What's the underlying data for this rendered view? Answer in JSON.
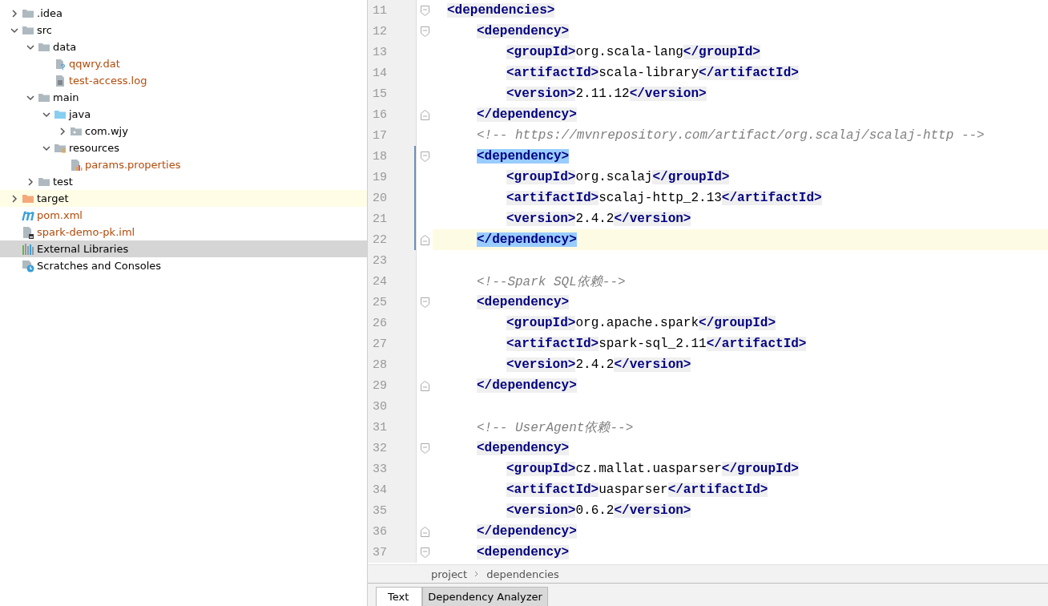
{
  "project_tree": [
    {
      "name": ".idea",
      "kind": "folder",
      "expanded": false,
      "untracked": false,
      "selected": false,
      "hovered": false
    },
    {
      "name": "src",
      "kind": "folder",
      "expanded": true,
      "untracked": false,
      "selected": false,
      "hovered": false,
      "children": [
        {
          "name": "data",
          "kind": "folder",
          "expanded": true,
          "untracked": false,
          "selected": false,
          "hovered": false,
          "children": [
            {
              "name": "qqwry.dat",
              "kind": "unknown-file",
              "untracked": true,
              "selected": false,
              "hovered": false
            },
            {
              "name": "test-access.log",
              "kind": "text-file",
              "untracked": true,
              "selected": false,
              "hovered": false
            }
          ]
        },
        {
          "name": "main",
          "kind": "folder",
          "expanded": true,
          "untracked": false,
          "selected": false,
          "hovered": false,
          "children": [
            {
              "name": "java",
              "kind": "source-folder",
              "expanded": true,
              "untracked": false,
              "selected": false,
              "hovered": false,
              "children": [
                {
                  "name": "com.wjy",
                  "kind": "package",
                  "expanded": false,
                  "untracked": false,
                  "selected": false,
                  "hovered": false
                }
              ]
            },
            {
              "name": "resources",
              "kind": "resource-folder",
              "expanded": true,
              "untracked": false,
              "selected": false,
              "hovered": false,
              "children": [
                {
                  "name": "params.properties",
                  "kind": "properties-file",
                  "untracked": true,
                  "selected": false,
                  "hovered": false
                }
              ]
            }
          ]
        },
        {
          "name": "test",
          "kind": "folder",
          "expanded": false,
          "untracked": false,
          "selected": false,
          "hovered": false
        }
      ]
    },
    {
      "name": "target",
      "kind": "excluded-folder",
      "expanded": false,
      "untracked": false,
      "selected": false,
      "hovered": true
    },
    {
      "name": "pom.xml",
      "kind": "maven-file",
      "untracked": true,
      "selected": false,
      "hovered": false
    },
    {
      "name": "spark-demo-pk.iml",
      "kind": "module-file",
      "untracked": true,
      "selected": false,
      "hovered": false
    }
  ],
  "tree_roots": [
    {
      "name": "External Libraries",
      "kind": "libraries",
      "selected": true
    },
    {
      "name": "Scratches and Consoles",
      "kind": "scratches",
      "selected": false
    }
  ],
  "editor": {
    "lines": [
      {
        "number": "11",
        "kind": "tag",
        "open": "<dependencies>",
        "fold_start": true,
        "changed": false,
        "current": false,
        "matched": false,
        "children": [
          {
            "number": "12",
            "kind": "tag",
            "open": "<dependency>",
            "fold_start": true,
            "changed": false,
            "current": false,
            "matched": false,
            "children": [
              {
                "number": "13",
                "kind": "element",
                "open": "<groupId>",
                "value": "org.scala-lang",
                "close": "</groupId>",
                "changed": false,
                "current": false,
                "matched": false
              },
              {
                "number": "14",
                "kind": "element",
                "open": "<artifactId>",
                "value": "scala-library",
                "close": "</artifactId>",
                "changed": false,
                "current": false,
                "matched": false
              },
              {
                "number": "15",
                "kind": "element",
                "open": "<version>",
                "value": "2.11.12",
                "close": "</version>",
                "changed": false,
                "current": false,
                "matched": false
              }
            ]
          },
          {
            "number": "16",
            "kind": "tag",
            "open": "</dependency>",
            "fold_end": true,
            "changed": false,
            "current": false,
            "matched": false
          },
          {
            "number": "17",
            "kind": "comment",
            "text": "<!-- https://mvnrepository.com/artifact/org.scalaj/scalaj-http -->",
            "changed": false,
            "current": false
          },
          {
            "number": "18",
            "kind": "tag",
            "open": "<dependency>",
            "fold_start": true,
            "changed": true,
            "current": false,
            "matched": true,
            "children": [
              {
                "number": "19",
                "kind": "element",
                "open": "<groupId>",
                "value": "org.scalaj",
                "close": "</groupId>",
                "changed": true,
                "current": false,
                "matched": false
              },
              {
                "number": "20",
                "kind": "element",
                "open": "<artifactId>",
                "value": "scalaj-http_2.13",
                "close": "</artifactId>",
                "changed": true,
                "current": false,
                "matched": false
              },
              {
                "number": "21",
                "kind": "element",
                "open": "<version>",
                "value": "2.4.2",
                "close": "</version>",
                "changed": true,
                "current": false,
                "matched": false
              }
            ]
          },
          {
            "number": "22",
            "kind": "tag",
            "open": "</dependency>",
            "fold_end": true,
            "changed": true,
            "current": true,
            "matched": true
          },
          {
            "number": "23",
            "kind": "blank",
            "changed": false,
            "current": false
          },
          {
            "number": "24",
            "kind": "comment",
            "text": "<!--Spark SQL依赖-->",
            "changed": false,
            "current": false
          },
          {
            "number": "25",
            "kind": "tag",
            "open": "<dependency>",
            "fold_start": true,
            "changed": false,
            "current": false,
            "matched": false,
            "children": [
              {
                "number": "26",
                "kind": "element",
                "open": "<groupId>",
                "value": "org.apache.spark",
                "close": "</groupId>",
                "changed": false,
                "current": false,
                "matched": false
              },
              {
                "number": "27",
                "kind": "element",
                "open": "<artifactId>",
                "value": "spark-sql_2.11",
                "close": "</artifactId>",
                "changed": false,
                "current": false,
                "matched": false
              },
              {
                "number": "28",
                "kind": "element",
                "open": "<version>",
                "value": "2.4.2",
                "close": "</version>",
                "changed": false,
                "current": false,
                "matched": false
              }
            ]
          },
          {
            "number": "29",
            "kind": "tag",
            "open": "</dependency>",
            "fold_end": true,
            "changed": false,
            "current": false,
            "matched": false
          },
          {
            "number": "30",
            "kind": "blank",
            "changed": false,
            "current": false
          },
          {
            "number": "31",
            "kind": "comment",
            "text": "<!-- UserAgent依赖-->",
            "changed": false,
            "current": false
          },
          {
            "number": "32",
            "kind": "tag",
            "open": "<dependency>",
            "fold_start": true,
            "changed": false,
            "current": false,
            "matched": false,
            "children": [
              {
                "number": "33",
                "kind": "element",
                "open": "<groupId>",
                "value": "cz.mallat.uasparser",
                "close": "</groupId>",
                "changed": false,
                "current": false,
                "matched": false
              },
              {
                "number": "34",
                "kind": "element",
                "open": "<artifactId>",
                "value": "uasparser",
                "close": "</artifactId>",
                "changed": false,
                "current": false,
                "matched": false
              },
              {
                "number": "35",
                "kind": "element",
                "open": "<version>",
                "value": "0.6.2",
                "close": "</version>",
                "changed": false,
                "current": false,
                "matched": false
              }
            ]
          },
          {
            "number": "36",
            "kind": "tag",
            "open": "</dependency>",
            "fold_end": true,
            "changed": false,
            "current": false,
            "matched": false
          },
          {
            "number": "37",
            "kind": "tag",
            "open": "<dependency>",
            "fold_start": true,
            "changed": false,
            "current": false,
            "matched": false
          }
        ]
      }
    ]
  },
  "breadcrumbs": [
    "project",
    "dependencies"
  ],
  "bottom_tabs": [
    {
      "label": "Text",
      "selected": true
    },
    {
      "label": "Dependency Analyzer",
      "selected": false
    }
  ]
}
